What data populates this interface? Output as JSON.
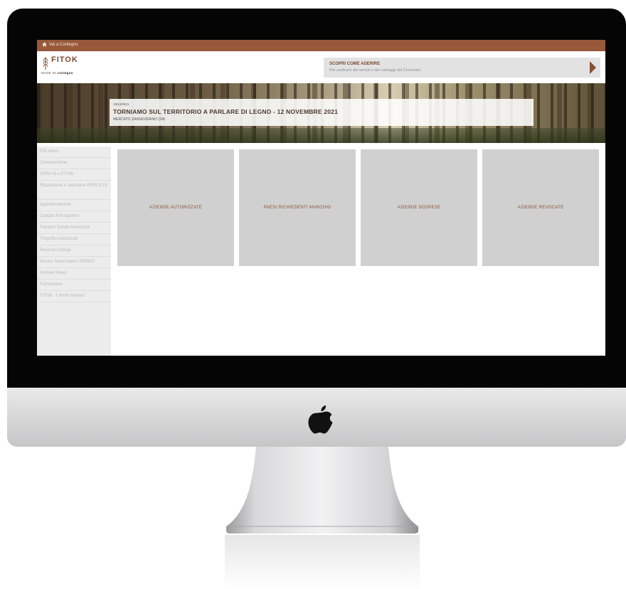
{
  "topbar": {
    "link_label": "Vai a Conlegno"
  },
  "header": {
    "logo_word": "FITOK",
    "logo_tag_prefix": "MADE IN",
    "logo_tag_brand": "conlegno",
    "join_title": "SCOPRI COME ADERIRE",
    "join_subtitle": "Per usufruire dei servizi e dei vantaggi del Consorzio"
  },
  "hero": {
    "date": "19/10/2021",
    "title": "TORNIAMO SUL TERRITORIO A PARLARE DI LEGNO - 12 NOVEMBRE 2021",
    "place": "MERCATO SANSEVERINO (SA)"
  },
  "sidebar": {
    "items": [
      {
        "label": "Chi siamo"
      },
      {
        "label": "Composizione"
      },
      {
        "label": "ISPM-15 e FITOK"
      },
      {
        "label": "Riparazione e selezione ISPM N.15"
      },
      {
        "label": "Approfondimenti"
      },
      {
        "label": "Contatti Enti Ispettivi"
      },
      {
        "label": "Fornitori Sonde Autorizzati"
      },
      {
        "label": "Timprifici Autorizzati"
      },
      {
        "label": "Reverse Charge"
      },
      {
        "label": "Elenco Smarchiatori ISPM15"
      },
      {
        "label": "Archivio News"
      },
      {
        "label": "Formazione"
      },
      {
        "label": "FITOK - I Nostri Numeri"
      }
    ]
  },
  "tiles": [
    {
      "label": "AZIENDE AUTORIZZATE"
    },
    {
      "label": "PAESI RICHIEDENTI MARCHIO"
    },
    {
      "label": "AZIENDE SOSPESE"
    },
    {
      "label": "AZIENDE REVOCATE"
    }
  ],
  "colors": {
    "accent": "#98583a",
    "tile_bg": "#d0d0d0",
    "sidebar_bg": "#ececec"
  },
  "icons": {
    "topbar": "home-icon",
    "join": "triangle-right-icon",
    "device": "apple-logo-icon"
  }
}
